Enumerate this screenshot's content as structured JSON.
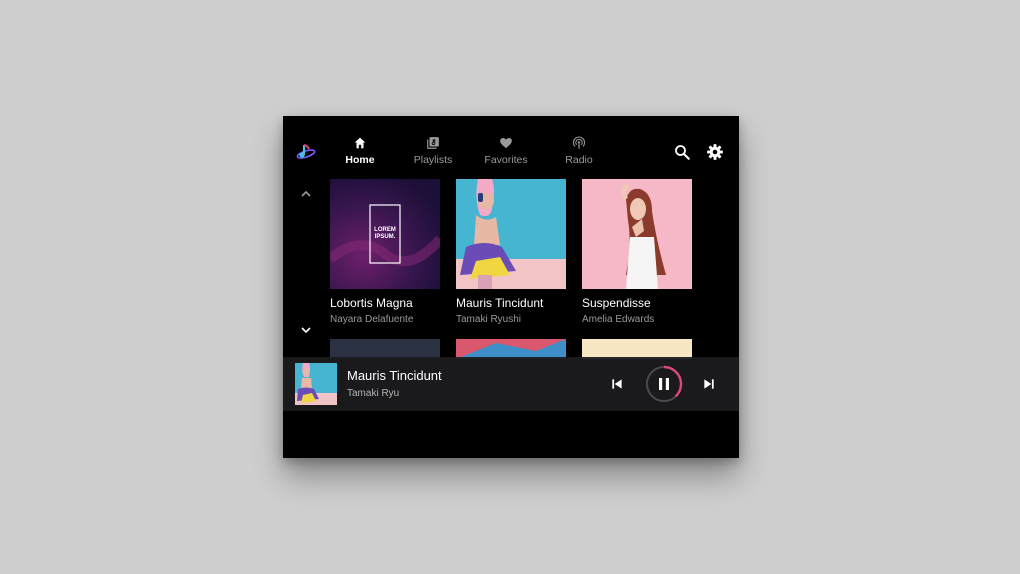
{
  "tabs": [
    {
      "label": "Home",
      "icon": "home-icon",
      "active": true
    },
    {
      "label": "Playlists",
      "icon": "playlists-icon",
      "active": false
    },
    {
      "label": "Favorites",
      "icon": "heart-icon",
      "active": false
    },
    {
      "label": "Radio",
      "icon": "radio-icon",
      "active": false
    }
  ],
  "cards": [
    {
      "title": "Lobortis Magna",
      "artist": "Nayara Delafuente",
      "cover_text": "LOREM IPSUM."
    },
    {
      "title": "Mauris Tincidunt",
      "artist": "Tamaki Ryushi"
    },
    {
      "title": "Suspendisse",
      "artist": "Amelia Edwards"
    }
  ],
  "now_playing": {
    "title": "Mauris Tincidunt",
    "artist": "Tamaki Ryu",
    "progress": 0.38
  },
  "colors": {
    "background": "#000000",
    "accent": "#e0457b",
    "text_secondary": "#9a9a9a"
  }
}
